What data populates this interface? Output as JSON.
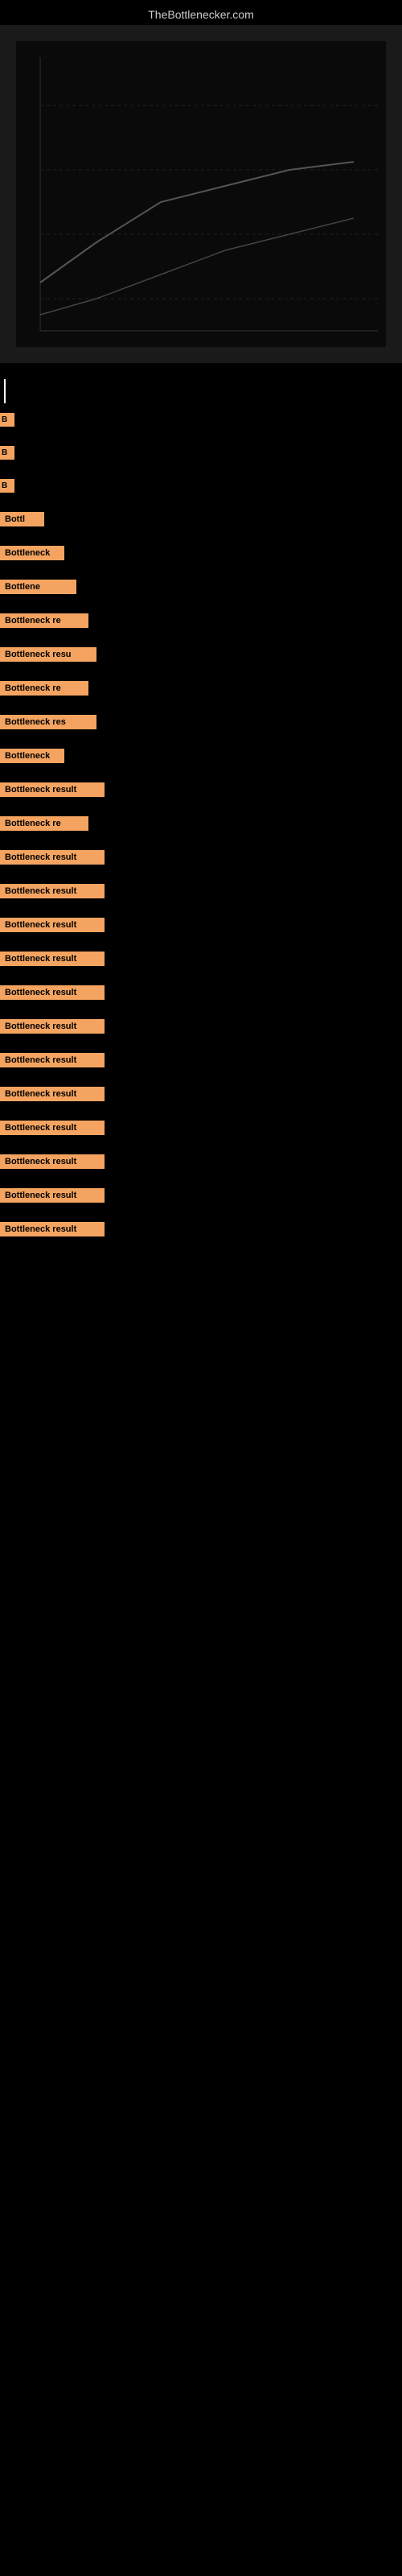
{
  "site": {
    "title": "TheBottlenecker.com"
  },
  "results": [
    {
      "id": 1,
      "label": "Bottleneck result",
      "badge_size": "badge-xs",
      "display": "B"
    },
    {
      "id": 2,
      "label": "Bottleneck result",
      "badge_size": "badge-xs",
      "display": "B"
    },
    {
      "id": 3,
      "label": "Bottleneck result",
      "badge_size": "badge-xs",
      "display": "B"
    },
    {
      "id": 4,
      "label": "Bottleneck result",
      "badge_size": "badge-md",
      "display": "Bottl"
    },
    {
      "id": 5,
      "label": "Bottleneck result",
      "badge_size": "badge-lg",
      "display": "Bottleneck"
    },
    {
      "id": 6,
      "label": "Bottleneck result",
      "badge_size": "badge-xl",
      "display": "Bottlene"
    },
    {
      "id": 7,
      "label": "Bottleneck result",
      "badge_size": "badge-xxl",
      "display": "Bottleneck re"
    },
    {
      "id": 8,
      "label": "Bottleneck result",
      "badge_size": "badge-xxxl",
      "display": "Bottleneck resu"
    },
    {
      "id": 9,
      "label": "Bottleneck result",
      "badge_size": "badge-xxl",
      "display": "Bottleneck re"
    },
    {
      "id": 10,
      "label": "Bottleneck result",
      "badge_size": "badge-xxxl",
      "display": "Bottleneck res"
    },
    {
      "id": 11,
      "label": "Bottleneck result",
      "badge_size": "badge-lg",
      "display": "Bottleneck"
    },
    {
      "id": 12,
      "label": "Bottleneck result",
      "badge_size": "badge-full",
      "display": "Bottleneck result"
    },
    {
      "id": 13,
      "label": "Bottleneck result",
      "badge_size": "badge-xxl",
      "display": "Bottleneck re"
    },
    {
      "id": 14,
      "label": "Bottleneck result",
      "badge_size": "badge-full",
      "display": "Bottleneck result"
    },
    {
      "id": 15,
      "label": "Bottleneck result",
      "badge_size": "badge-full",
      "display": "Bottleneck result"
    },
    {
      "id": 16,
      "label": "Bottleneck result",
      "badge_size": "badge-full",
      "display": "Bottleneck result"
    },
    {
      "id": 17,
      "label": "Bottleneck result",
      "badge_size": "badge-full",
      "display": "Bottleneck result"
    },
    {
      "id": 18,
      "label": "Bottleneck result",
      "badge_size": "badge-full",
      "display": "Bottleneck result"
    },
    {
      "id": 19,
      "label": "Bottleneck result",
      "badge_size": "badge-full",
      "display": "Bottleneck result"
    },
    {
      "id": 20,
      "label": "Bottleneck result",
      "badge_size": "badge-full",
      "display": "Bottleneck result"
    },
    {
      "id": 21,
      "label": "Bottleneck result",
      "badge_size": "badge-full",
      "display": "Bottleneck result"
    },
    {
      "id": 22,
      "label": "Bottleneck result",
      "badge_size": "badge-full",
      "display": "Bottleneck result"
    },
    {
      "id": 23,
      "label": "Bottleneck result",
      "badge_size": "badge-full",
      "display": "Bottleneck result"
    },
    {
      "id": 24,
      "label": "Bottleneck result",
      "badge_size": "badge-full",
      "display": "Bottleneck result"
    },
    {
      "id": 25,
      "label": "Bottleneck result",
      "badge_size": "badge-full",
      "display": "Bottleneck result"
    }
  ]
}
